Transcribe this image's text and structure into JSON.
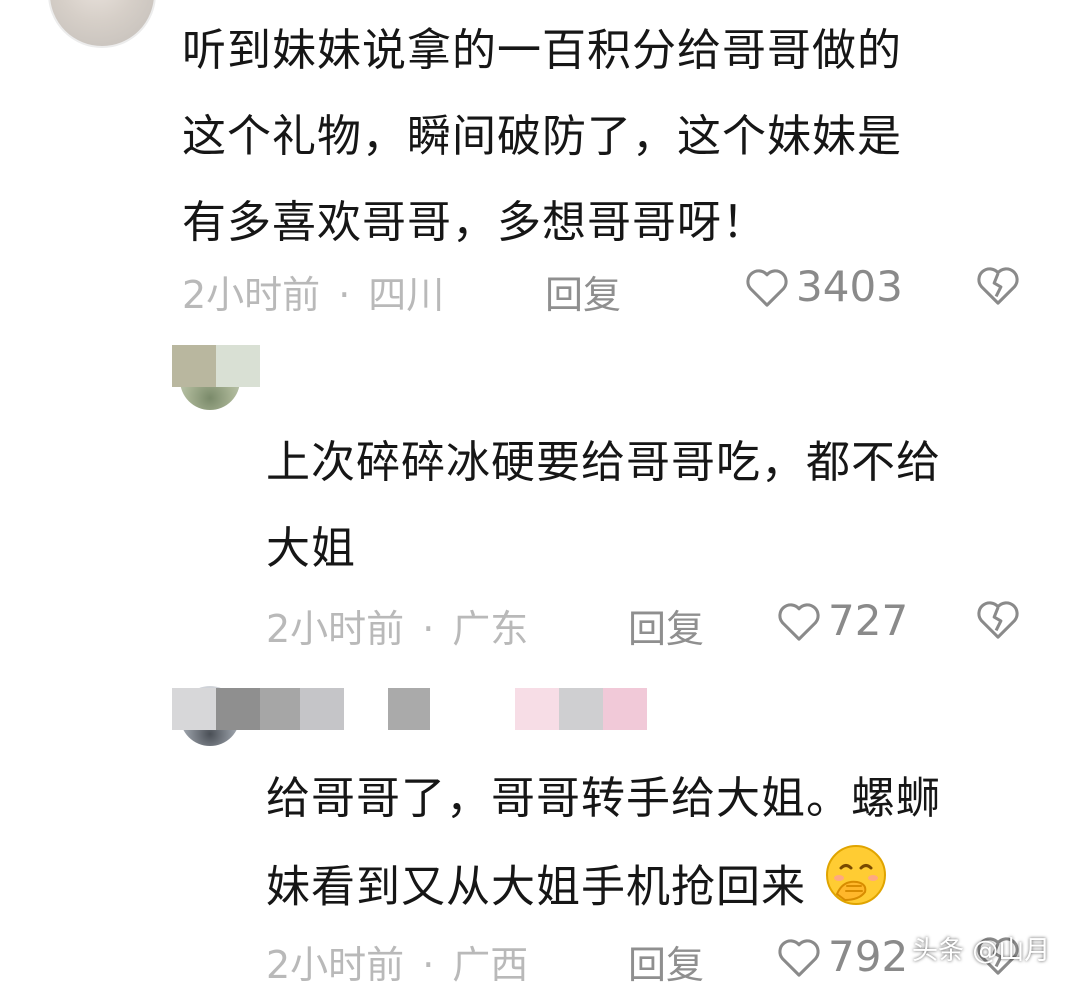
{
  "comment1": {
    "lines": [
      "听到妹妹说拿的一百积分给哥哥做的",
      "这个礼物，瞬间破防了，这个妹妹是",
      "有多喜欢哥哥，多想哥哥呀！"
    ],
    "time": "2小时前",
    "dot": "·",
    "location": "四川",
    "reply": "回复",
    "likes": "3403"
  },
  "comment2": {
    "lines": [
      "上次碎碎冰硬要给哥哥吃，都不给",
      "大姐"
    ],
    "time": "2小时前",
    "dot": "·",
    "location": "广东",
    "reply": "回复",
    "likes": "727"
  },
  "comment3": {
    "lines": [
      "给哥哥了，哥哥转手给大姐。螺蛳",
      "妹看到又从大姐手机抢回来"
    ],
    "time": "2小时前",
    "dot": "·",
    "location": "广西",
    "reply": "回复",
    "likes": "792"
  },
  "icons": {
    "like": "heart-outline-icon",
    "dislike": "broken-heart-icon",
    "emoji": "hand-over-mouth-emoji"
  },
  "watermark": "头条 @山月",
  "colors": {
    "text": "#161616",
    "meta": "#b9b9b9",
    "icon": "#8a8a8a"
  }
}
